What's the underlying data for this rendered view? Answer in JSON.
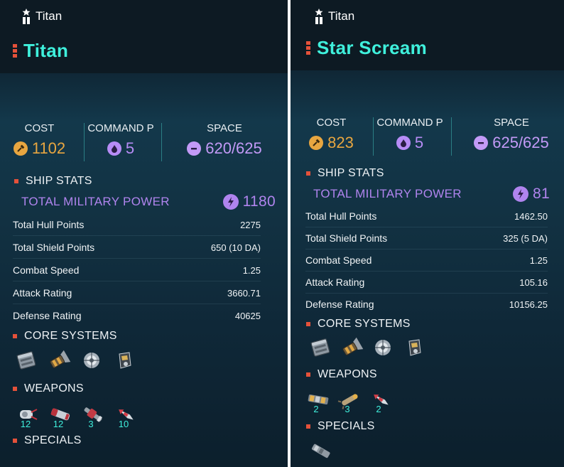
{
  "colors": {
    "accent_name": "#3ff0dc",
    "section_marker": "#e4513a",
    "cost": "#e8a640",
    "command": "#b78cf6",
    "power": "#b084ee"
  },
  "panels": [
    {
      "ship_type": "Titan",
      "ship_name": "Titan",
      "summary": {
        "cost_label": "COST",
        "cost_value": "1102",
        "command_label": "COMMAND P",
        "command_value": "5",
        "space_label": "SPACE",
        "space_value": "620/625"
      },
      "ship_stats_label": "SHIP STATS",
      "total_military_power_label": "TOTAL MILITARY POWER",
      "total_military_power_value": "1180",
      "stats": [
        {
          "name": "Total Hull Points",
          "value": "2275"
        },
        {
          "name": "Total Shield Points",
          "value": "650 (10 DA)"
        },
        {
          "name": "Combat Speed",
          "value": "1.25"
        },
        {
          "name": "Attack Rating",
          "value": "3660.71"
        },
        {
          "name": "Defense Rating",
          "value": "40625"
        }
      ],
      "core_systems_label": "CORE SYSTEMS",
      "core_systems": [
        {
          "icon": "armor-plating-module-icon",
          "count": ""
        },
        {
          "icon": "thruster-module-icon",
          "count": ""
        },
        {
          "icon": "reactor-module-icon",
          "count": ""
        },
        {
          "icon": "sensor-module-icon",
          "count": ""
        }
      ],
      "weapons_label": "WEAPONS",
      "weapons": [
        {
          "icon": "gatling-gun-weapon-icon",
          "count": "12"
        },
        {
          "icon": "cannon-weapon-icon",
          "count": "12"
        },
        {
          "icon": "railgun-weapon-icon",
          "count": "3"
        },
        {
          "icon": "missile-weapon-icon",
          "count": "10"
        }
      ],
      "specials_label": "SPECIALS",
      "specials": []
    },
    {
      "ship_type": "Titan",
      "ship_name": "Star Scream",
      "summary": {
        "cost_label": "COST",
        "cost_value": "823",
        "command_label": "COMMAND P",
        "command_value": "5",
        "space_label": "SPACE",
        "space_value": "625/625"
      },
      "ship_stats_label": "SHIP STATS",
      "total_military_power_label": "TOTAL MILITARY POWER",
      "total_military_power_value": "81",
      "stats": [
        {
          "name": "Total Hull Points",
          "value": "1462.50"
        },
        {
          "name": "Total Shield Points",
          "value": "325 (5 DA)"
        },
        {
          "name": "Combat Speed",
          "value": "1.25"
        },
        {
          "name": "Attack Rating",
          "value": "105.16"
        },
        {
          "name": "Defense Rating",
          "value": "10156.25"
        }
      ],
      "core_systems_label": "CORE SYSTEMS",
      "core_systems": [
        {
          "icon": "armor-plating-module-icon",
          "count": ""
        },
        {
          "icon": "thruster-module-icon",
          "count": ""
        },
        {
          "icon": "reactor-module-icon",
          "count": ""
        },
        {
          "icon": "sensor-module-icon",
          "count": ""
        }
      ],
      "weapons_label": "WEAPONS",
      "weapons": [
        {
          "icon": "laser-battery-weapon-icon",
          "count": "2"
        },
        {
          "icon": "torpedo-launcher-weapon-icon",
          "count": "3"
        },
        {
          "icon": "missile-weapon-icon",
          "count": "2"
        }
      ],
      "specials_label": "SPECIALS",
      "specials": [
        {
          "icon": "special-module-icon",
          "count": ""
        }
      ]
    }
  ]
}
